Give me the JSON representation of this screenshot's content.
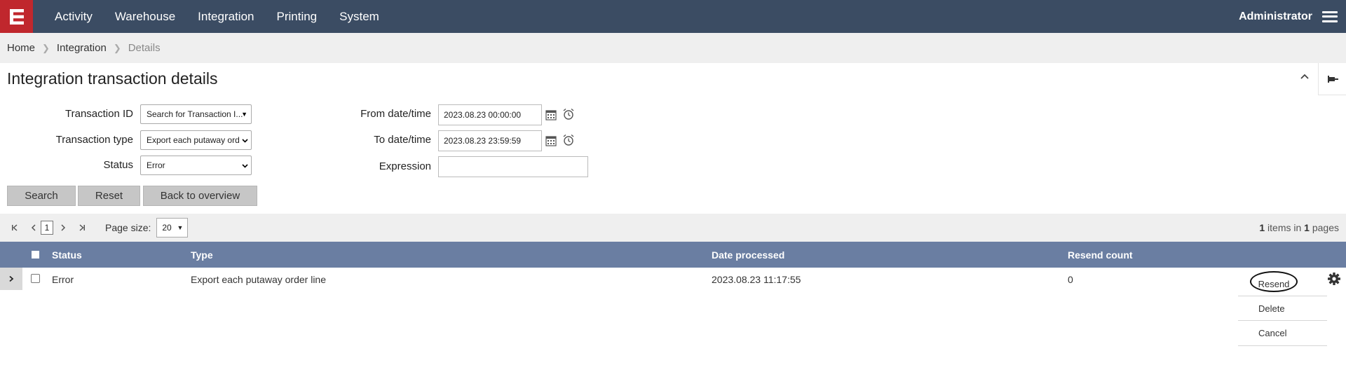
{
  "app": {
    "logo_letter": "E",
    "brand_color": "#c0272d",
    "nav_bg": "#3b4c63"
  },
  "nav": {
    "items": [
      "Activity",
      "Warehouse",
      "Integration",
      "Printing",
      "System"
    ],
    "user": "Administrator",
    "menu_icon": "hamburger-icon"
  },
  "breadcrumb": {
    "items": [
      "Home",
      "Integration",
      "Details"
    ],
    "separator_icon": "chevron-right-icon"
  },
  "page": {
    "title": "Integration transaction details"
  },
  "form": {
    "transaction_id": {
      "label": "Transaction ID",
      "placeholder": "Search for Transaction I..."
    },
    "transaction_type": {
      "label": "Transaction type",
      "value": "Export each putaway ord"
    },
    "status": {
      "label": "Status",
      "value": "Error"
    },
    "from_date": {
      "label": "From date/time",
      "value": "2023.08.23 00:00:00"
    },
    "to_date": {
      "label": "To date/time",
      "value": "2023.08.23 23:59:59"
    },
    "expression": {
      "label": "Expression",
      "value": ""
    }
  },
  "buttons": {
    "search": "Search",
    "reset": "Reset",
    "back": "Back to overview"
  },
  "pager": {
    "current_page": "1",
    "page_size_label": "Page size:",
    "page_size": "20",
    "items_count": "1",
    "items_text_1": "items in",
    "pages_count": "1",
    "items_text_2": "pages"
  },
  "table": {
    "header_bg": "#6a7ea2",
    "columns": [
      "Status",
      "Type",
      "Date processed",
      "Resend count"
    ],
    "rows": [
      {
        "status": "Error",
        "type": "Export each putaway order line",
        "date": "2023.08.23 11:17:55",
        "resend_count": "0"
      }
    ]
  },
  "actions": {
    "resend": "Resend",
    "delete": "Delete",
    "cancel": "Cancel"
  }
}
